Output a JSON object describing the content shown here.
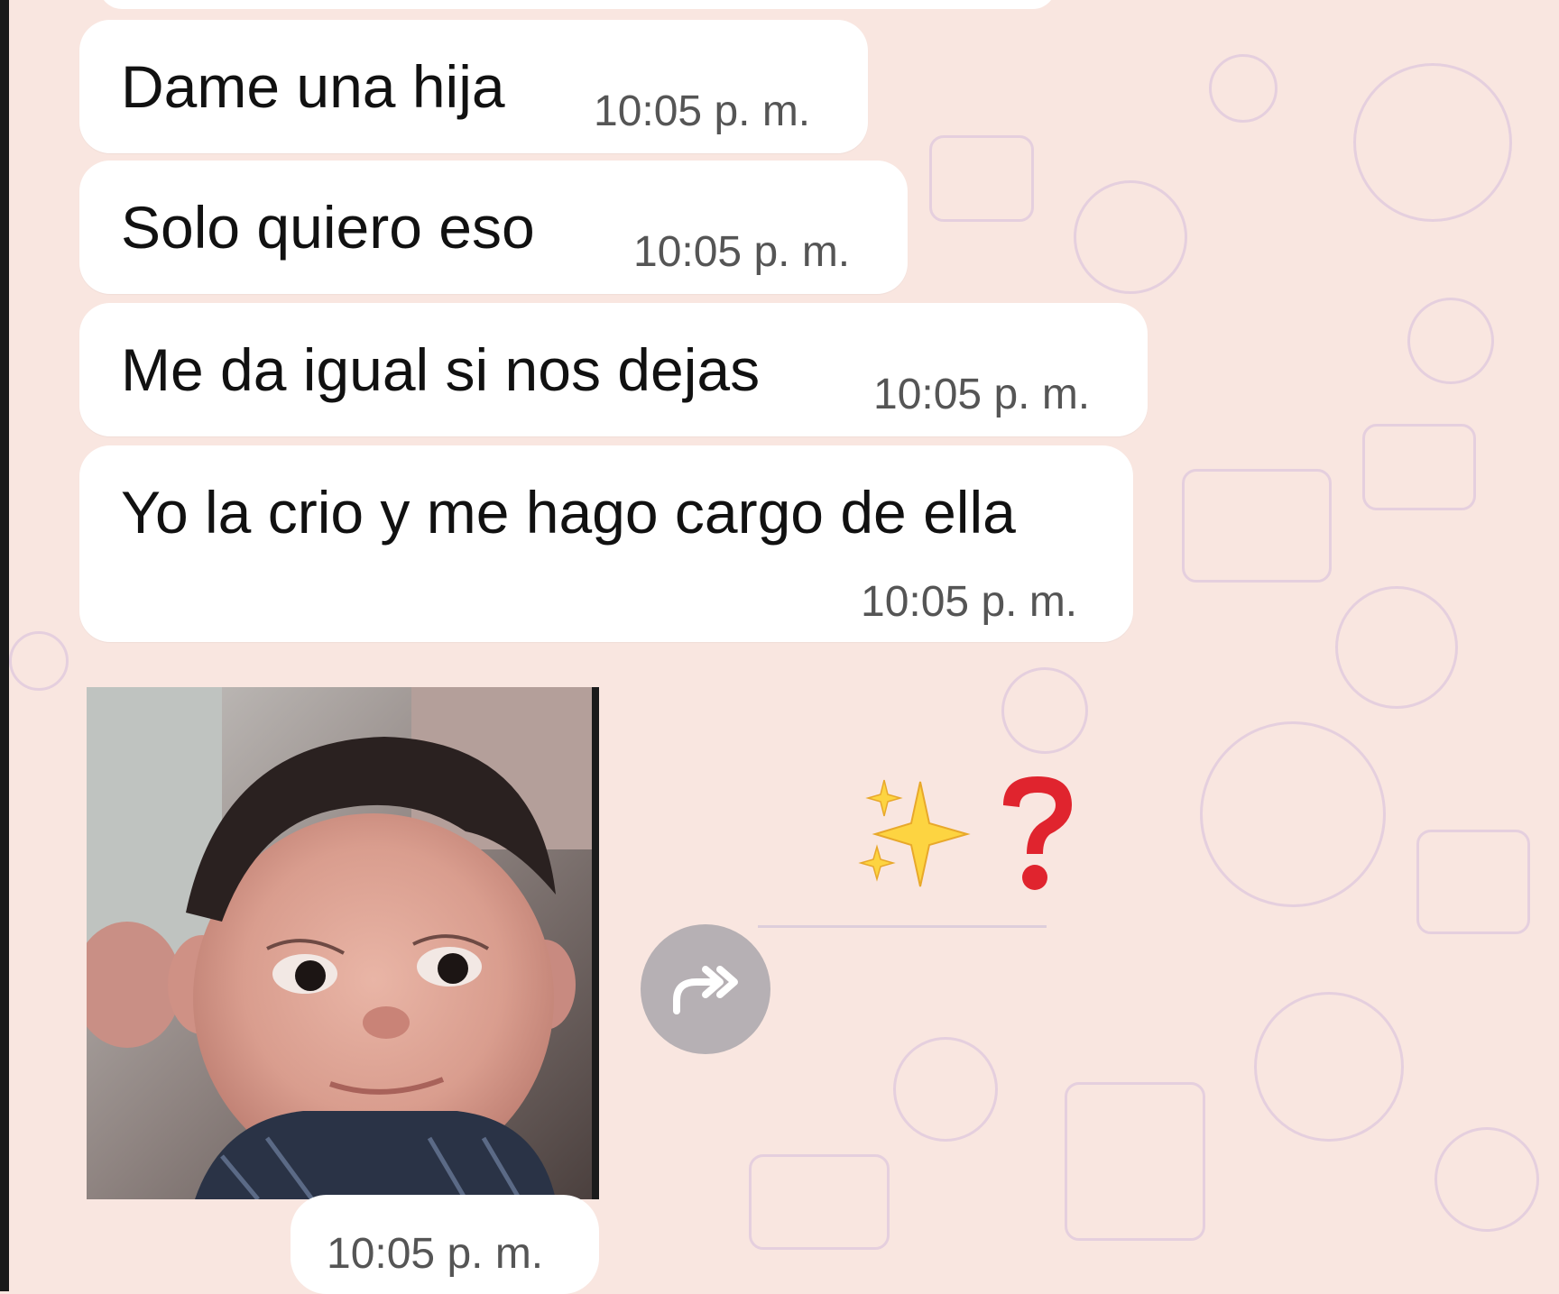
{
  "chat": {
    "messages": [
      {
        "text": "Dame una hija",
        "time": "10:05 p. m."
      },
      {
        "text": "Solo quiero eso",
        "time": "10:05 p. m."
      },
      {
        "text": "Me da igual si nos dejas",
        "time": "10:05 p. m."
      },
      {
        "text": "Yo la crio y me hago cargo de ella",
        "time": "10:05 p. m."
      }
    ],
    "image_message": {
      "time": "10:05 p. m.",
      "forward_icon": "forward-icon"
    },
    "emoji_message": {
      "emojis": [
        "sparkles-icon",
        "red-question-mark-icon"
      ]
    }
  },
  "colors": {
    "wallpaper": "#f9e6e0",
    "bubble": "#ffffff",
    "text": "#111111",
    "time": "#555555",
    "forward_button": "#b6b0b4",
    "doodle": "#cdb4dc"
  }
}
